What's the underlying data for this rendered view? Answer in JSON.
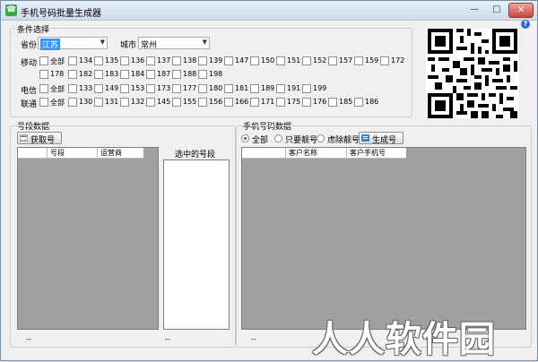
{
  "window": {
    "title": "手机号码批量生成器",
    "min": "—",
    "max": "□",
    "close": "✕"
  },
  "conditions": {
    "group_label": "条件选择",
    "province_label": "省份",
    "province_value": "江苏",
    "city_label": "城市",
    "city_value": "常州",
    "rows": [
      {
        "label": "移动",
        "all": "全部",
        "prefixes": [
          "134",
          "135",
          "136",
          "137",
          "138",
          "139",
          "147",
          "150",
          "151",
          "152",
          "157",
          "159",
          "172"
        ]
      },
      {
        "label": "",
        "all": "",
        "prefixes": [
          "178",
          "182",
          "183",
          "184",
          "187",
          "188",
          "198"
        ]
      },
      {
        "label": "电信",
        "all": "全部",
        "prefixes": [
          "133",
          "149",
          "153",
          "173",
          "177",
          "180",
          "181",
          "189",
          "191",
          "199"
        ]
      },
      {
        "label": "联通",
        "all": "全部",
        "prefixes": [
          "130",
          "131",
          "132",
          "145",
          "155",
          "156",
          "166",
          "171",
          "175",
          "176",
          "185",
          "186"
        ]
      }
    ]
  },
  "segments": {
    "group_label": "号段数据",
    "fetch_button": "获取号段",
    "columns": [
      "号段",
      "运营商"
    ],
    "selected_label": "选中的号段",
    "status_left": "--",
    "status_right": "--"
  },
  "phones": {
    "group_label": "手机号码数据",
    "radio_all": "全部",
    "radio_good": "只要靓号",
    "radio_filter": "虑除靓号",
    "generate_button": "生成号码",
    "columns": [
      "客户名称",
      "客户手机号"
    ],
    "status": "--"
  },
  "watermark": "人人软件园",
  "help": "?"
}
